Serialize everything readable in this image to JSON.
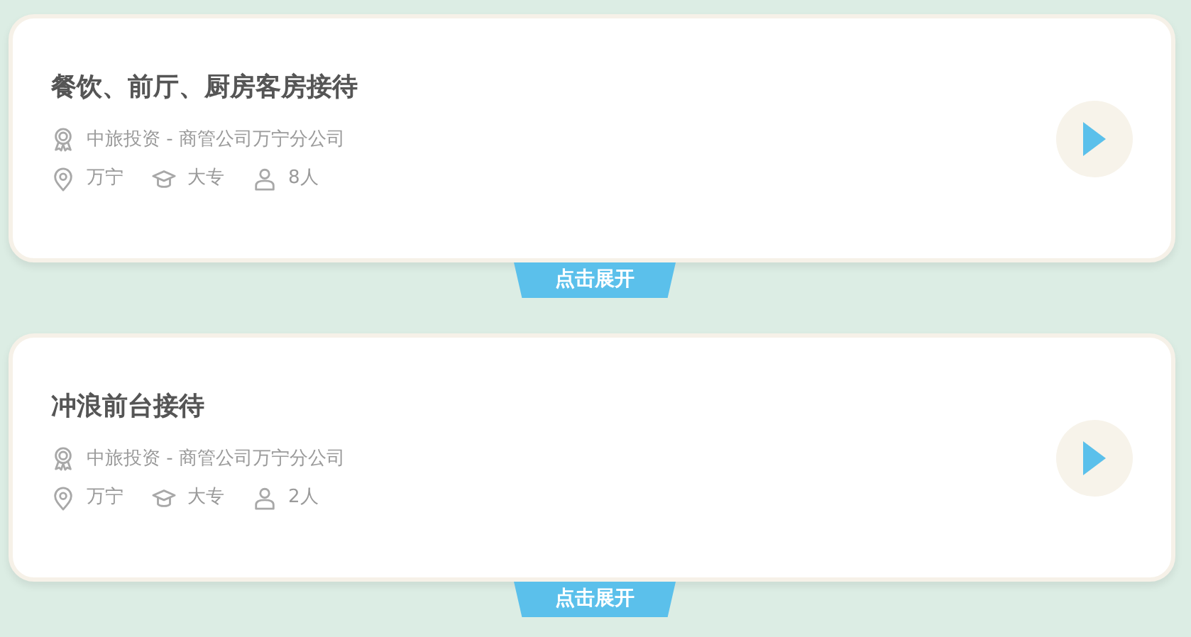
{
  "jobs": [
    {
      "title": "餐饮、前厅、厨房客房接待",
      "company": "中旅投资 - 商管公司万宁分公司",
      "location": "万宁",
      "education": "大专",
      "headcount": "8人",
      "expand": "点击展开"
    },
    {
      "title": "冲浪前台接待",
      "company": "中旅投资 - 商管公司万宁分公司",
      "location": "万宁",
      "education": "大专",
      "headcount": "2人",
      "expand": "点击展开"
    }
  ]
}
